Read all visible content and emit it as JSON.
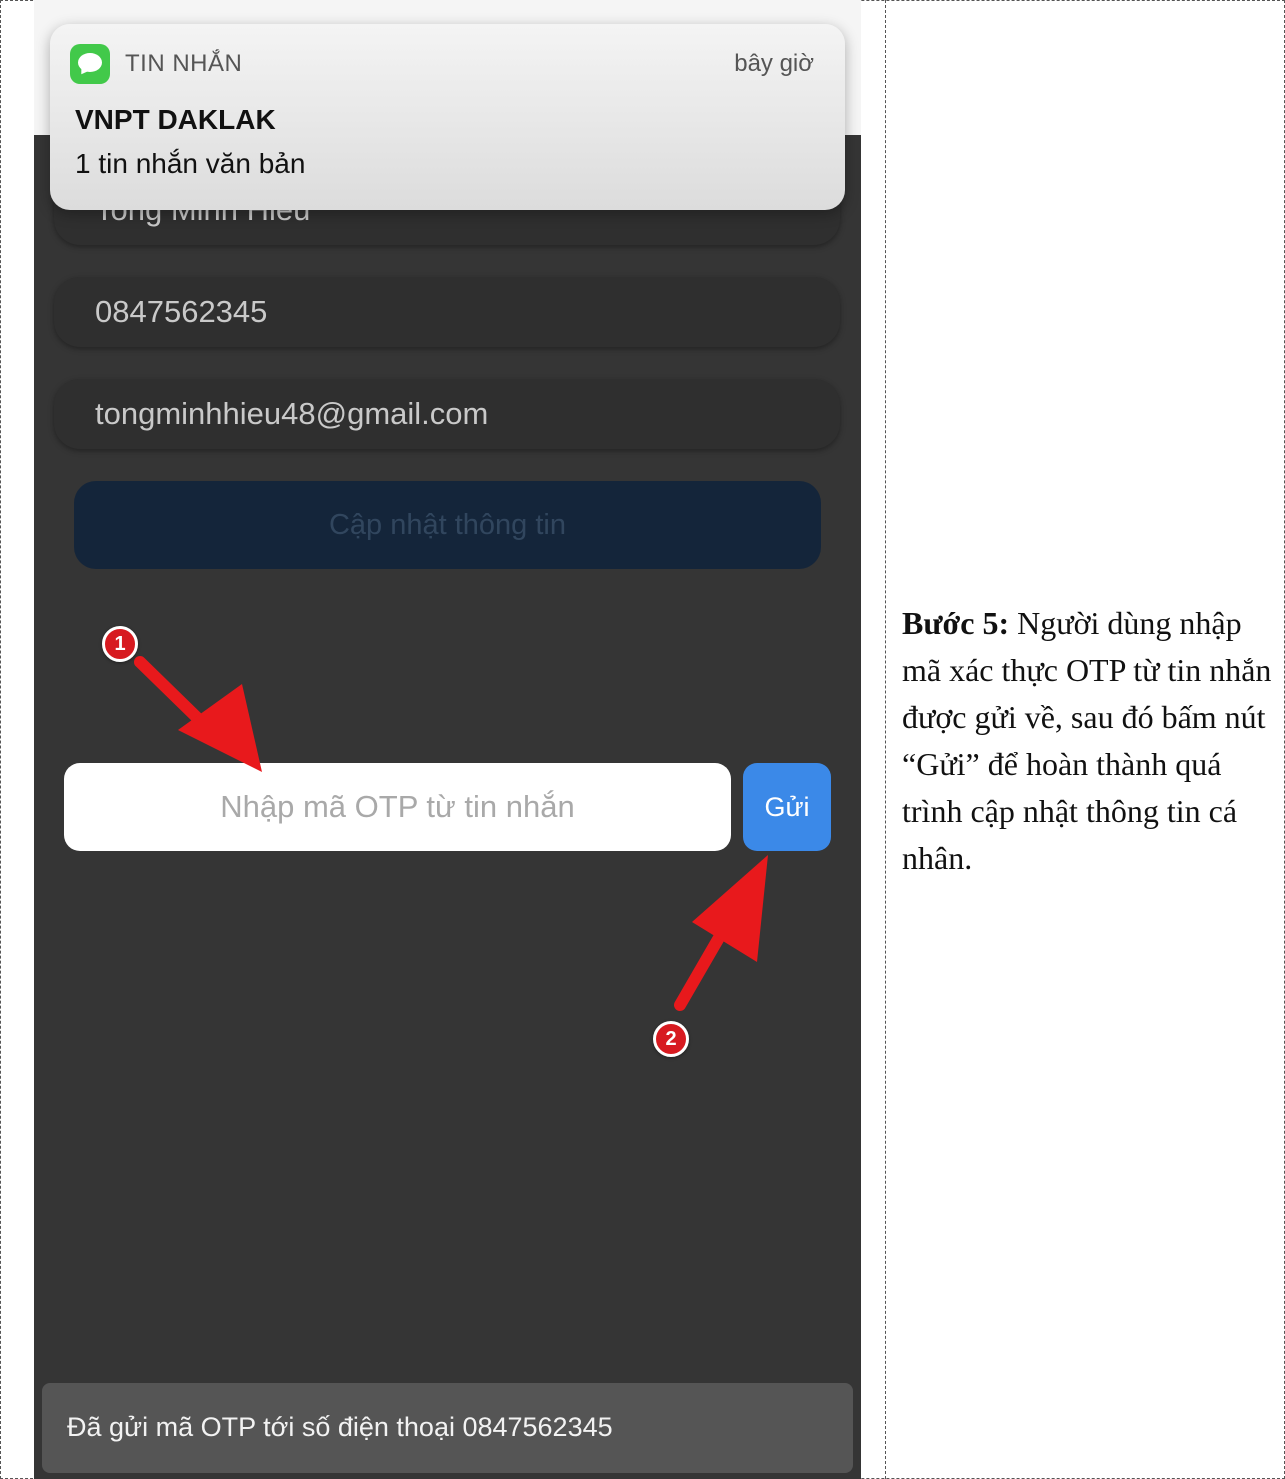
{
  "notification": {
    "app_name": "TIN NHẮN",
    "time": "bây giờ",
    "sender": "VNPT DAKLAK",
    "body": "1 tin nhắn văn bản",
    "icon": "messages-icon"
  },
  "form": {
    "name_value": "Tong Minh Hieu",
    "phone_value": "0847562345",
    "email_value": "tongminhhieu48@gmail.com",
    "update_button": "Cập nhật thông tin"
  },
  "otp": {
    "placeholder": "Nhập mã OTP từ tin nhắn",
    "send_button": "Gửi"
  },
  "toast": "Đã gửi mã OTP tới số điện thoại 0847562345",
  "markers": [
    "1",
    "2"
  ],
  "instruction": {
    "step_label": "Bước 5:",
    "text": " Người dùng nhập mã xác thực OTP từ tin nhắn được gửi về, sau đó bấm nút “Gửi” để hoàn thành quá trình cập nhật thông tin cá nhân."
  },
  "colors": {
    "screen_bg": "#353535",
    "send_button": "#3b89e8",
    "update_button": "#14253a",
    "annotation_red": "#e8191c",
    "notification_icon": "#42c94a"
  }
}
